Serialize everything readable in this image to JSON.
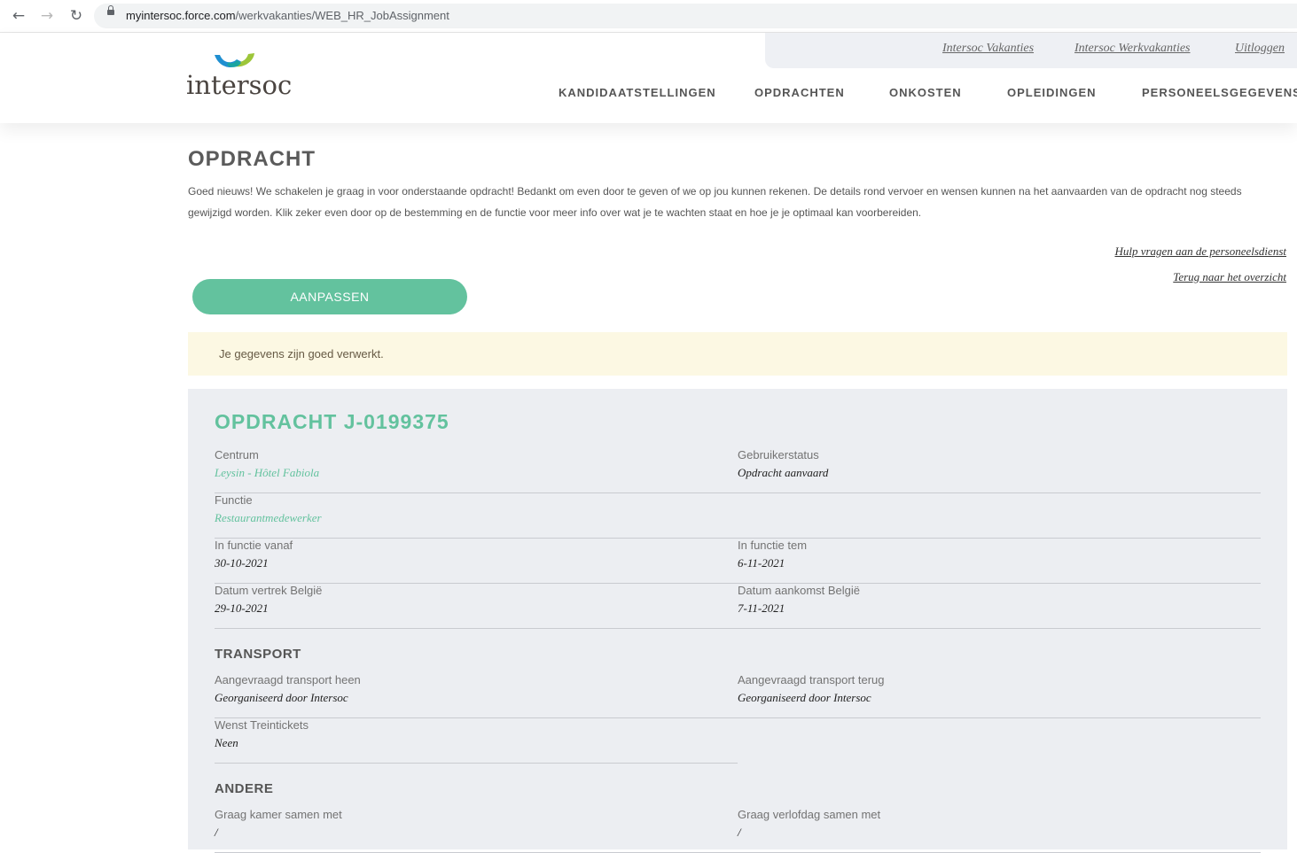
{
  "browser": {
    "url_host": "myintersoc.force.com",
    "url_path": "/werkvakanties/WEB_HR_JobAssignment"
  },
  "header": {
    "logo_text": "intersoc",
    "top_links": [
      "Intersoc Vakanties",
      "Intersoc Werkvakanties",
      "Uitloggen"
    ],
    "nav": [
      "KANDIDAATSTELLINGEN",
      "OPDRACHTEN",
      "ONKOSTEN",
      "OPLEIDINGEN",
      "PERSONEELSGEGEVENS"
    ]
  },
  "page": {
    "title": "OPDRACHT",
    "intro": "Goed nieuws! We schakelen je graag in voor onderstaande opdracht! Bedankt om even door te geven of we op jou kunnen rekenen. De details rond vervoer en wensen kunnen na het aanvaarden van de opdracht nog steeds gewijzigd worden. Klik zeker even door op de bestemming en de functie voor meer info over wat je te wachten staat en hoe je je optimaal kan voorbereiden.",
    "help_link": "Hulp vragen aan de personeelsdienst",
    "back_link": "Terug naar het overzicht",
    "edit_button": "AANPASSEN",
    "success_message": "Je gegevens zijn goed verwerkt."
  },
  "assignment": {
    "title": "OPDRACHT J-0199375",
    "centrum_label": "Centrum",
    "centrum_value": "Leysin - Hôtel Fabiola",
    "status_label": "Gebruikerstatus",
    "status_value": "Opdracht aanvaard",
    "functie_label": "Functie",
    "functie_value": "Restaurantmedewerker",
    "vanaf_label": "In functie vanaf",
    "vanaf_value": "30-10-2021",
    "tem_label": "In functie tem",
    "tem_value": "6-11-2021",
    "vertrek_label": "Datum vertrek België",
    "vertrek_value": "29-10-2021",
    "aankomst_label": "Datum aankomst België",
    "aankomst_value": "7-11-2021"
  },
  "transport": {
    "title": "TRANSPORT",
    "heen_label": "Aangevraagd transport heen",
    "heen_value": "Georganiseerd door Intersoc",
    "terug_label": "Aangevraagd transport terug",
    "terug_value": "Georganiseerd door Intersoc",
    "trein_label": "Wenst Treintickets",
    "trein_value": "Neen"
  },
  "andere": {
    "title": "ANDERE",
    "kamer_label": "Graag kamer samen met",
    "kamer_value": "/",
    "verlof_label": "Graag verlofdag samen met",
    "verlof_value": "/"
  }
}
